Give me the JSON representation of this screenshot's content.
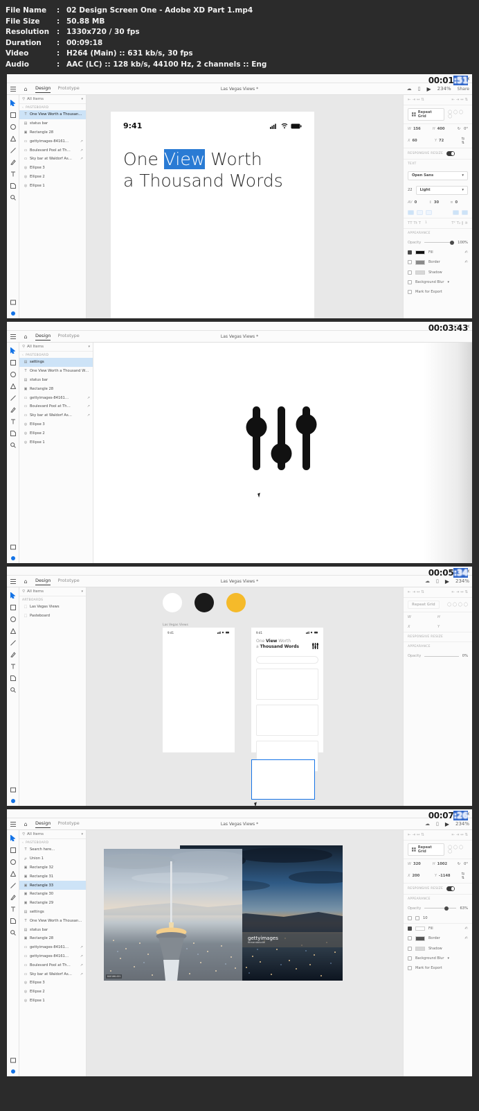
{
  "meta": {
    "rows": [
      {
        "key": "File Name",
        "value": "02 Design Screen One - Adobe XD Part 1.mp4"
      },
      {
        "key": "File Size",
        "value": "50.88 MB"
      },
      {
        "key": "Resolution",
        "value": "1330x720 / 30 fps"
      },
      {
        "key": "Duration",
        "value": "00:09:18"
      },
      {
        "key": "Video",
        "value": "H264 (Main) :: 631 kb/s, 30 fps"
      },
      {
        "key": "Audio",
        "value": "AAC (LC) :: 128 kb/s, 44100 Hz, 2 channels :: Eng"
      }
    ],
    "colon": ":"
  },
  "common": {
    "app_tabs": {
      "design": "Design",
      "prototype": "Prototype"
    },
    "doc_title": "Las Vegas Views *",
    "search_placeholder": "All Items",
    "group_pasteboard": "PASTEBOARD",
    "group_artboards": "ARTBOARDS",
    "zoom_level": "234%",
    "share_label": "Share",
    "win_min": "–",
    "win_max": "□",
    "win_close": "✕"
  },
  "properties": {
    "repeat_grid": "Repeat Grid",
    "responsive_resize": "RESPONSIVE RESIZE",
    "text_label": "TEXT",
    "appearance_label": "APPEARANCE",
    "opacity_label": "Opacity",
    "font_family": "Open Sans",
    "font_size": "22",
    "font_weight": "Light",
    "letter_spacing": "0",
    "line_height": "30",
    "paragraph_spacing": "0",
    "fill": "Fill",
    "border": "Border",
    "shadow": "Shadow",
    "background_blur": "Background Blur",
    "mark_for_export": "Mark for Export"
  },
  "frames": [
    {
      "id": "frame-1",
      "timestamp": {
        "prefix": "00:01",
        "highlight": ":51"
      },
      "layers": {
        "group": "PASTEBOARD",
        "items": [
          {
            "label": "One View Worth a Thousand Words",
            "icon": "text-icon",
            "selected": true,
            "linked": false
          },
          {
            "label": "status bar",
            "icon": "group-icon",
            "selected": false,
            "linked": false
          },
          {
            "label": "Rectangle 28",
            "icon": "rect-icon",
            "selected": false,
            "linked": false
          },
          {
            "label": "gettyimages-84161…",
            "icon": "image-icon",
            "selected": false,
            "linked": true
          },
          {
            "label": "Boulevard Pool at Th…",
            "icon": "image-icon",
            "selected": false,
            "linked": true
          },
          {
            "label": "Sky bar at Waldorf As…",
            "icon": "image-icon",
            "selected": false,
            "linked": true
          },
          {
            "label": "Ellipse 3",
            "icon": "ellipse-icon",
            "selected": false,
            "linked": false
          },
          {
            "label": "Ellipse 2",
            "icon": "ellipse-icon",
            "selected": false,
            "linked": false
          },
          {
            "label": "Ellipse 1",
            "icon": "ellipse-icon",
            "selected": false,
            "linked": false
          }
        ]
      },
      "props": {
        "w_label": "W",
        "w_value": "156",
        "h_label": "H",
        "h_value": "400",
        "x_label": "X",
        "x_value": "60",
        "y_label": "Y",
        "y_value": "72",
        "rotation": "0°",
        "opacity_value": "100%"
      },
      "phone": {
        "time": "9:41",
        "headline_pre": "One ",
        "headline_sel": "View",
        "headline_post": " Worth",
        "headline_line2": "a Thousand Words"
      }
    },
    {
      "id": "frame-2",
      "timestamp": {
        "prefix": "00:03",
        "highlight": ":43"
      },
      "layers": {
        "group": "PASTEBOARD",
        "items": [
          {
            "label": "settings",
            "icon": "group-icon",
            "selected": true,
            "linked": false
          },
          {
            "label": "One View Worth a Thousand Words",
            "icon": "text-icon",
            "selected": false,
            "linked": false
          },
          {
            "label": "status bar",
            "icon": "group-icon",
            "selected": false,
            "linked": false
          },
          {
            "label": "Rectangle 28",
            "icon": "rect-icon",
            "selected": false,
            "linked": false
          },
          {
            "label": "gettyimages-84161…",
            "icon": "image-icon",
            "selected": false,
            "linked": true
          },
          {
            "label": "Boulevard Pool at Th…",
            "icon": "image-icon",
            "selected": false,
            "linked": true
          },
          {
            "label": "Sky bar at Waldorf As…",
            "icon": "image-icon",
            "selected": false,
            "linked": true
          },
          {
            "label": "Ellipse 3",
            "icon": "ellipse-icon",
            "selected": false,
            "linked": false
          },
          {
            "label": "Ellipse 2",
            "icon": "ellipse-icon",
            "selected": false,
            "linked": false
          },
          {
            "label": "Ellipse 1",
            "icon": "ellipse-icon",
            "selected": false,
            "linked": false
          }
        ]
      },
      "canvas_note": "settings-sliders-icon"
    },
    {
      "id": "frame-3",
      "timestamp": {
        "prefix": "00:05",
        "highlight": ":34"
      },
      "layers": {
        "group": "ARTBOARDS",
        "items": [
          {
            "label": "Las Vegas Views",
            "icon": "artboard-icon",
            "selected": false,
            "linked": false
          },
          {
            "label": "Pasteboard",
            "icon": "artboard-icon",
            "selected": false,
            "linked": false
          }
        ]
      },
      "swatches": [
        {
          "name": "swatch-white",
          "color": "#FFFFFF"
        },
        {
          "name": "swatch-black",
          "color": "#1A1A1A"
        },
        {
          "name": "swatch-yellow",
          "color": "#F5BA2A"
        }
      ],
      "artboard_label": "Las Vegas Views",
      "artboard_a": {
        "time": "9:41"
      },
      "artboard_b": {
        "time": "9:41",
        "headline_line1_pre": "One ",
        "headline_line1_bold": "View",
        "headline_line1_post": " Worth",
        "headline_line2_pre": "a ",
        "headline_line2_bold": "Thousand Words"
      },
      "props": {
        "w_label": "W",
        "w_value": "",
        "h_label": "H",
        "h_value": "",
        "x_label": "X",
        "x_value": "",
        "y_label": "Y",
        "y_value": "",
        "opacity_value": "0%"
      }
    },
    {
      "id": "frame-4",
      "timestamp": {
        "prefix": "00:07",
        "highlight": ":26"
      },
      "layers": {
        "group": "PASTEBOARD",
        "items": [
          {
            "label": "Search here…",
            "icon": "text-icon",
            "selected": false,
            "linked": false
          },
          {
            "label": "Union 1",
            "icon": "path-icon",
            "selected": false,
            "linked": false
          },
          {
            "label": "Rectangle 32",
            "icon": "rect-icon",
            "selected": false,
            "linked": false
          },
          {
            "label": "Rectangle 31",
            "icon": "rect-icon",
            "selected": false,
            "linked": false
          },
          {
            "label": "Rectangle 33",
            "icon": "rect-icon",
            "selected": true,
            "linked": false
          },
          {
            "label": "Rectangle 30",
            "icon": "rect-icon",
            "selected": false,
            "linked": false
          },
          {
            "label": "Rectangle 29",
            "icon": "rect-icon",
            "selected": false,
            "linked": false
          },
          {
            "label": "settings",
            "icon": "group-icon",
            "selected": false,
            "linked": false
          },
          {
            "label": "One View Worth a Thousand Words",
            "icon": "text-icon",
            "selected": false,
            "linked": false
          },
          {
            "label": "status bar",
            "icon": "group-icon",
            "selected": false,
            "linked": false
          },
          {
            "label": "Rectangle 28",
            "icon": "rect-icon",
            "selected": false,
            "linked": false
          },
          {
            "label": "gettyimages-84161…",
            "icon": "image-icon",
            "selected": false,
            "linked": true
          },
          {
            "label": "gettyimages-84161…",
            "icon": "image-icon",
            "selected": false,
            "linked": true
          },
          {
            "label": "Boulevard Pool at Th…",
            "icon": "image-icon",
            "selected": false,
            "linked": true
          },
          {
            "label": "Sky bar at Waldorf As…",
            "icon": "image-icon",
            "selected": false,
            "linked": true
          },
          {
            "label": "Ellipse 3",
            "icon": "ellipse-icon",
            "selected": false,
            "linked": false
          },
          {
            "label": "Ellipse 2",
            "icon": "ellipse-icon",
            "selected": false,
            "linked": false
          },
          {
            "label": "Ellipse 1",
            "icon": "ellipse-icon",
            "selected": false,
            "linked": false
          }
        ]
      },
      "props": {
        "w_label": "W",
        "w_value": "320",
        "h_label": "H",
        "h_value": "1002",
        "x_label": "X",
        "x_value": "200",
        "y_label": "Y",
        "y_value": "-1148",
        "rotation": "0°",
        "opacity_value": "63%",
        "corner_radius": "10"
      },
      "getty": {
        "brand_bold": "getty",
        "brand_light": "images",
        "sub": "fernandoludle"
      },
      "image_tag": "840166-001"
    }
  ]
}
